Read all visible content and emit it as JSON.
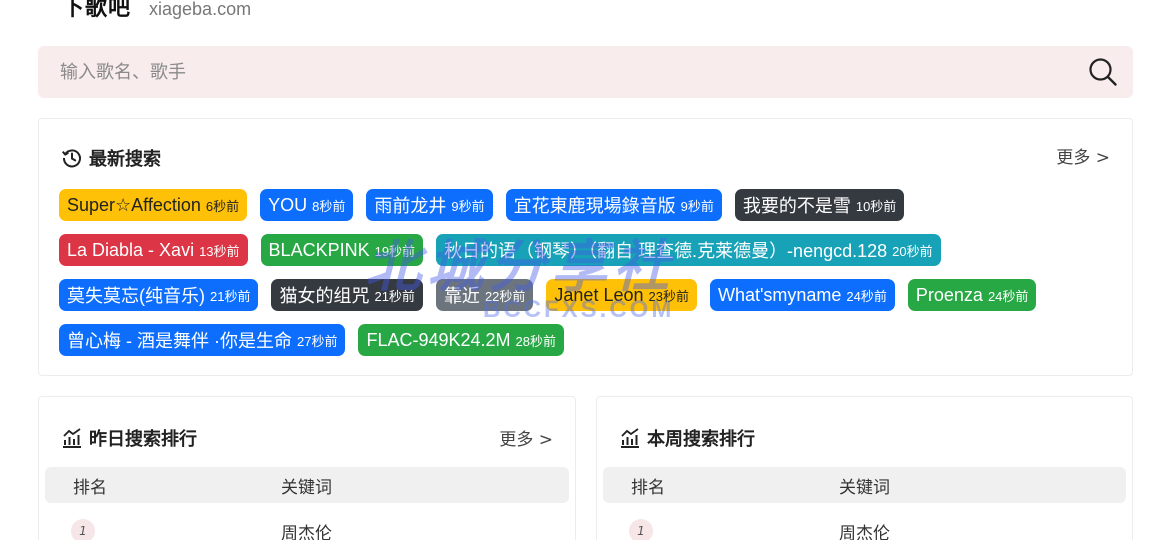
{
  "header": {
    "site_name": "下歌吧",
    "domain": "xiageba.com"
  },
  "search": {
    "placeholder": "输入歌名、歌手",
    "value": ""
  },
  "recent": {
    "title": "最新搜索",
    "more": "更多 >",
    "rows": [
      [
        {
          "text": "Super☆Affection",
          "time": "6秒前",
          "color": "yellow"
        },
        {
          "text": "YOU",
          "time": "8秒前",
          "color": "blue"
        },
        {
          "text": "雨前龙井",
          "time": "9秒前",
          "color": "blue"
        },
        {
          "text": "宜花東鹿現場錄音版",
          "time": "9秒前",
          "color": "blue"
        },
        {
          "text": "我要的不是雪",
          "time": "10秒前",
          "color": "dark"
        }
      ],
      [
        {
          "text": "La Diabla - Xavi",
          "time": "13秒前",
          "color": "red"
        },
        {
          "text": "BLACKPINK",
          "time": "19秒前",
          "color": "green"
        },
        {
          "text": "秋日的语（钢琴）（翻自 理查德.克莱德曼）-nengcd.128",
          "time": "20秒前",
          "color": "teal"
        }
      ],
      [
        {
          "text": "莫失莫忘(纯音乐)",
          "time": "21秒前",
          "color": "blue"
        },
        {
          "text": "猫女的组咒",
          "time": "21秒前",
          "color": "dark"
        },
        {
          "text": "靠近",
          "time": "22秒前",
          "color": "gray"
        },
        {
          "text": "Janet Leon",
          "time": "23秒前",
          "color": "yellow"
        },
        {
          "text": "What'smyname",
          "time": "24秒前",
          "color": "blue"
        },
        {
          "text": "Proenza",
          "time": "24秒前",
          "color": "green"
        }
      ],
      [
        {
          "text": "曾心梅 - 酒是舞伴 ·你是生命",
          "time": "27秒前",
          "color": "blue"
        },
        {
          "text": "FLAC-949K24.2M",
          "time": "28秒前",
          "color": "green"
        }
      ]
    ]
  },
  "yesterday": {
    "title": "昨日搜索排行",
    "more": "更多 >",
    "col_rank": "排名",
    "col_keyword": "关键词",
    "rows": [
      {
        "rank": "1",
        "keyword": "周杰伦"
      }
    ]
  },
  "week": {
    "title": "本周搜索排行",
    "col_rank": "排名",
    "col_keyword": "关键词",
    "rows": [
      {
        "rank": "1",
        "keyword": "周杰伦"
      }
    ]
  },
  "watermark": {
    "main": "北城分享社",
    "sub": "BCCFXS.COM"
  },
  "icons": {
    "search": "search-icon",
    "history": "history-icon",
    "chart": "bar-chart-icon"
  }
}
